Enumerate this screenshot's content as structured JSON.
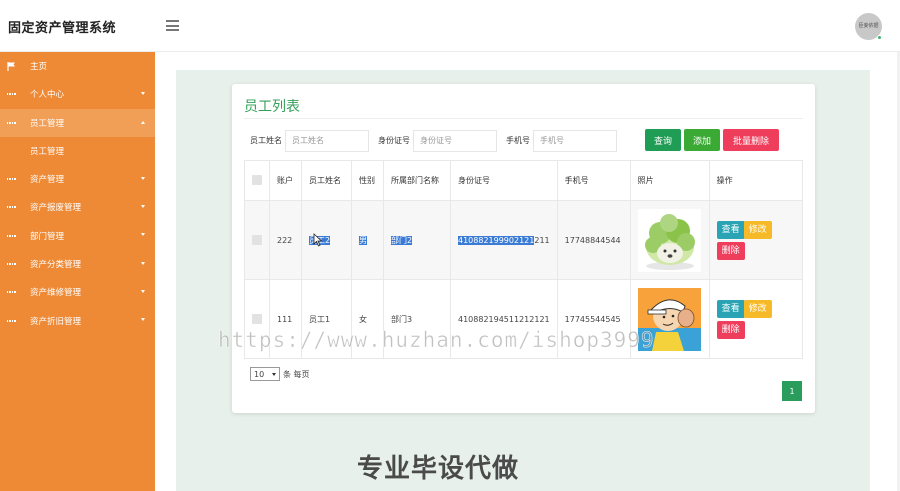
{
  "app": {
    "title": "固定资产管理系统",
    "avatar_text": "臣妾依据"
  },
  "colors": {
    "sidebar": "#ee8a36",
    "accent_green": "#35a05a",
    "btn_query": "#1f9d55",
    "btn_add": "#3aaa35",
    "btn_batch_delete": "#ef3d5c",
    "btn_view": "#2aa4b5",
    "btn_edit": "#f6b928",
    "btn_delete": "#ef3d5c"
  },
  "sidebar": {
    "items": [
      {
        "label": "主页",
        "icon": "flag-icon"
      },
      {
        "label": "个人中心",
        "icon": "grid-icon"
      },
      {
        "label": "员工管理",
        "icon": "grid-icon",
        "expanded": true,
        "sub": "员工管理"
      },
      {
        "label": "资产管理",
        "icon": "grid-icon"
      },
      {
        "label": "资产报废管理",
        "icon": "grid-icon"
      },
      {
        "label": "部门管理",
        "icon": "grid-icon"
      },
      {
        "label": "资产分类管理",
        "icon": "grid-icon"
      },
      {
        "label": "资产维修管理",
        "icon": "grid-icon"
      },
      {
        "label": "资产折旧管理",
        "icon": "grid-icon"
      }
    ]
  },
  "main": {
    "title": "员工列表",
    "search": {
      "name_label": "员工姓名",
      "name_placeholder": "员工姓名",
      "id_label": "身份证号",
      "id_placeholder": "身份证号",
      "phone_label": "手机号",
      "phone_placeholder": "手机号"
    },
    "buttons": {
      "query": "查询",
      "add": "添加",
      "batch_delete": "批量删除"
    },
    "table": {
      "headers": [
        "账户",
        "员工姓名",
        "性别",
        "所属部门名称",
        "身份证号",
        "手机号",
        "照片",
        "操作"
      ],
      "rows": [
        {
          "account": "222",
          "name": "员工2",
          "gender": "男",
          "dept": "部门2",
          "id_selected": "410882199902121",
          "id_rest": "211",
          "phone": "17748844544",
          "photo": "cabbage-photo"
        },
        {
          "account": "111",
          "name": "员工1",
          "gender": "女",
          "dept": "部门3",
          "id_selected": "",
          "id_rest": "410882194511212121",
          "phone": "17745544545",
          "photo": "cartoon-photo"
        }
      ],
      "actions": {
        "view": "查看",
        "edit": "修改",
        "delete": "删除"
      }
    },
    "pager": {
      "page_size": "10",
      "per_page_text": "条 每页",
      "current_page": "1"
    }
  },
  "watermark": "https://www.huzhan.com/ishop3999",
  "bottom_text": "专业毕设代做"
}
